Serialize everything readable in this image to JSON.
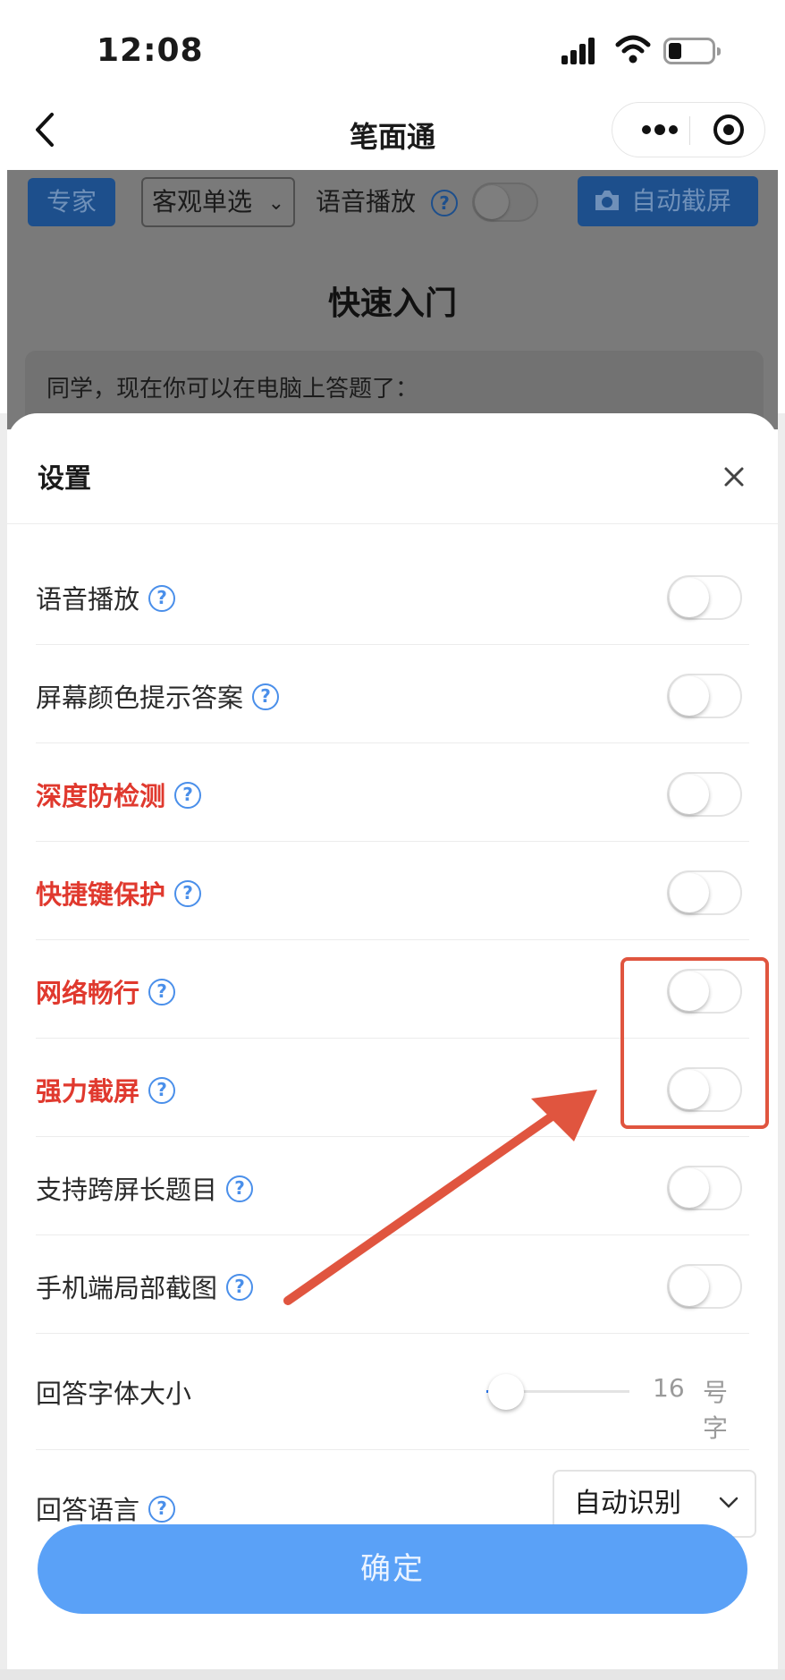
{
  "status_bar": {
    "time": "12:08"
  },
  "nav": {
    "title": "笔面通"
  },
  "background_page": {
    "expert_tag": "专家",
    "question_type": "客观单选",
    "voice_label": "语音播放",
    "help_glyph": "?",
    "auto_screenshot": "自动截屏",
    "heading": "快速入门",
    "card_text": "同学，现在你可以在电脑上答题了："
  },
  "settings": {
    "title": "设置",
    "help_glyph": "?",
    "items": [
      {
        "label": "语音播放",
        "enabled": false,
        "highlight": false
      },
      {
        "label": "屏幕颜色提示答案",
        "enabled": false,
        "highlight": false
      },
      {
        "label": "深度防检测",
        "enabled": false,
        "highlight": true
      },
      {
        "label": "快捷键保护",
        "enabled": false,
        "highlight": true
      },
      {
        "label": "网络畅行",
        "enabled": false,
        "highlight": true
      },
      {
        "label": "强力截屏",
        "enabled": false,
        "highlight": true
      },
      {
        "label": "支持跨屏长题目",
        "enabled": false,
        "highlight": false
      },
      {
        "label": "手机端局部截图",
        "enabled": false,
        "highlight": false
      }
    ],
    "font_size": {
      "label": "回答字体大小",
      "value": "16",
      "unit": "号字"
    },
    "language": {
      "label": "回答语言",
      "selected": "自动识别"
    },
    "confirm_label": "确定"
  },
  "colors": {
    "highlight_text": "#e0392e",
    "primary_button": "#5aa1f7",
    "help_icon": "#4a8fea",
    "annotation": "#e0553f"
  },
  "icons": [
    "back-chevron-icon",
    "more-dots-icon",
    "target-icon",
    "close-icon",
    "help-icon",
    "camera-icon",
    "chevron-down-icon",
    "signal-icon",
    "wifi-icon",
    "battery-icon"
  ]
}
